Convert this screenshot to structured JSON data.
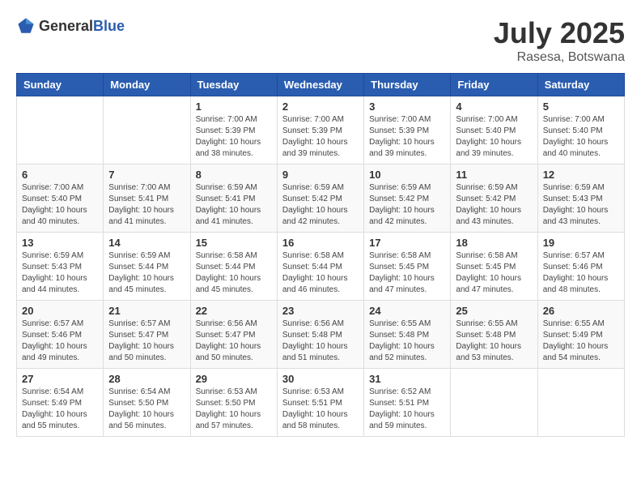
{
  "header": {
    "logo": {
      "general": "General",
      "blue": "Blue"
    },
    "title": "July 2025",
    "location": "Rasesa, Botswana"
  },
  "weekdays": [
    "Sunday",
    "Monday",
    "Tuesday",
    "Wednesday",
    "Thursday",
    "Friday",
    "Saturday"
  ],
  "weeks": [
    [
      {
        "day": "",
        "info": ""
      },
      {
        "day": "",
        "info": ""
      },
      {
        "day": "1",
        "info": "Sunrise: 7:00 AM\nSunset: 5:39 PM\nDaylight: 10 hours\nand 38 minutes."
      },
      {
        "day": "2",
        "info": "Sunrise: 7:00 AM\nSunset: 5:39 PM\nDaylight: 10 hours\nand 39 minutes."
      },
      {
        "day": "3",
        "info": "Sunrise: 7:00 AM\nSunset: 5:39 PM\nDaylight: 10 hours\nand 39 minutes."
      },
      {
        "day": "4",
        "info": "Sunrise: 7:00 AM\nSunset: 5:40 PM\nDaylight: 10 hours\nand 39 minutes."
      },
      {
        "day": "5",
        "info": "Sunrise: 7:00 AM\nSunset: 5:40 PM\nDaylight: 10 hours\nand 40 minutes."
      }
    ],
    [
      {
        "day": "6",
        "info": "Sunrise: 7:00 AM\nSunset: 5:40 PM\nDaylight: 10 hours\nand 40 minutes."
      },
      {
        "day": "7",
        "info": "Sunrise: 7:00 AM\nSunset: 5:41 PM\nDaylight: 10 hours\nand 41 minutes."
      },
      {
        "day": "8",
        "info": "Sunrise: 6:59 AM\nSunset: 5:41 PM\nDaylight: 10 hours\nand 41 minutes."
      },
      {
        "day": "9",
        "info": "Sunrise: 6:59 AM\nSunset: 5:42 PM\nDaylight: 10 hours\nand 42 minutes."
      },
      {
        "day": "10",
        "info": "Sunrise: 6:59 AM\nSunset: 5:42 PM\nDaylight: 10 hours\nand 42 minutes."
      },
      {
        "day": "11",
        "info": "Sunrise: 6:59 AM\nSunset: 5:42 PM\nDaylight: 10 hours\nand 43 minutes."
      },
      {
        "day": "12",
        "info": "Sunrise: 6:59 AM\nSunset: 5:43 PM\nDaylight: 10 hours\nand 43 minutes."
      }
    ],
    [
      {
        "day": "13",
        "info": "Sunrise: 6:59 AM\nSunset: 5:43 PM\nDaylight: 10 hours\nand 44 minutes."
      },
      {
        "day": "14",
        "info": "Sunrise: 6:59 AM\nSunset: 5:44 PM\nDaylight: 10 hours\nand 45 minutes."
      },
      {
        "day": "15",
        "info": "Sunrise: 6:58 AM\nSunset: 5:44 PM\nDaylight: 10 hours\nand 45 minutes."
      },
      {
        "day": "16",
        "info": "Sunrise: 6:58 AM\nSunset: 5:44 PM\nDaylight: 10 hours\nand 46 minutes."
      },
      {
        "day": "17",
        "info": "Sunrise: 6:58 AM\nSunset: 5:45 PM\nDaylight: 10 hours\nand 47 minutes."
      },
      {
        "day": "18",
        "info": "Sunrise: 6:58 AM\nSunset: 5:45 PM\nDaylight: 10 hours\nand 47 minutes."
      },
      {
        "day": "19",
        "info": "Sunrise: 6:57 AM\nSunset: 5:46 PM\nDaylight: 10 hours\nand 48 minutes."
      }
    ],
    [
      {
        "day": "20",
        "info": "Sunrise: 6:57 AM\nSunset: 5:46 PM\nDaylight: 10 hours\nand 49 minutes."
      },
      {
        "day": "21",
        "info": "Sunrise: 6:57 AM\nSunset: 5:47 PM\nDaylight: 10 hours\nand 50 minutes."
      },
      {
        "day": "22",
        "info": "Sunrise: 6:56 AM\nSunset: 5:47 PM\nDaylight: 10 hours\nand 50 minutes."
      },
      {
        "day": "23",
        "info": "Sunrise: 6:56 AM\nSunset: 5:48 PM\nDaylight: 10 hours\nand 51 minutes."
      },
      {
        "day": "24",
        "info": "Sunrise: 6:55 AM\nSunset: 5:48 PM\nDaylight: 10 hours\nand 52 minutes."
      },
      {
        "day": "25",
        "info": "Sunrise: 6:55 AM\nSunset: 5:48 PM\nDaylight: 10 hours\nand 53 minutes."
      },
      {
        "day": "26",
        "info": "Sunrise: 6:55 AM\nSunset: 5:49 PM\nDaylight: 10 hours\nand 54 minutes."
      }
    ],
    [
      {
        "day": "27",
        "info": "Sunrise: 6:54 AM\nSunset: 5:49 PM\nDaylight: 10 hours\nand 55 minutes."
      },
      {
        "day": "28",
        "info": "Sunrise: 6:54 AM\nSunset: 5:50 PM\nDaylight: 10 hours\nand 56 minutes."
      },
      {
        "day": "29",
        "info": "Sunrise: 6:53 AM\nSunset: 5:50 PM\nDaylight: 10 hours\nand 57 minutes."
      },
      {
        "day": "30",
        "info": "Sunrise: 6:53 AM\nSunset: 5:51 PM\nDaylight: 10 hours\nand 58 minutes."
      },
      {
        "day": "31",
        "info": "Sunrise: 6:52 AM\nSunset: 5:51 PM\nDaylight: 10 hours\nand 59 minutes."
      },
      {
        "day": "",
        "info": ""
      },
      {
        "day": "",
        "info": ""
      }
    ]
  ]
}
